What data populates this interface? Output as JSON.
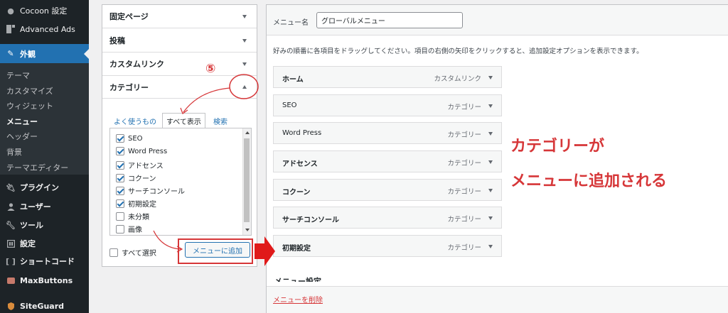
{
  "sidebar": {
    "items": [
      {
        "label": "Cocoon 設定",
        "icon": "circle-icon"
      },
      {
        "label": "Advanced Ads",
        "icon": "ads-icon"
      },
      {
        "label": "外観",
        "icon": "brush-icon"
      },
      {
        "label": "プラグイン",
        "icon": "plugin-icon"
      },
      {
        "label": "ユーザー",
        "icon": "user-icon"
      },
      {
        "label": "ツール",
        "icon": "wrench-icon"
      },
      {
        "label": "設定",
        "icon": "settings-icon"
      },
      {
        "label": "ショートコード",
        "icon": "shortcode-icon"
      },
      {
        "label": "MaxButtons",
        "icon": "maxbuttons-icon"
      },
      {
        "label": "SiteGuard",
        "icon": "siteguard-icon"
      }
    ],
    "submenu": [
      "テーマ",
      "カスタマイズ",
      "ウィジェット",
      "メニュー",
      "ヘッダー",
      "背景",
      "テーマエディター"
    ]
  },
  "left_panel": {
    "sections": [
      "固定ページ",
      "投稿",
      "カスタムリンク",
      "カテゴリー"
    ],
    "tabs": [
      "よく使うもの",
      "すべて表示",
      "検索"
    ],
    "categories": [
      {
        "label": "SEO",
        "checked": true
      },
      {
        "label": "Word Press",
        "checked": true
      },
      {
        "label": "アドセンス",
        "checked": true
      },
      {
        "label": "コクーン",
        "checked": true
      },
      {
        "label": "サーチコンソール",
        "checked": true
      },
      {
        "label": "初期設定",
        "checked": true
      },
      {
        "label": "未分類",
        "checked": false
      },
      {
        "label": "画像",
        "checked": false
      }
    ],
    "select_all_label": "すべて選択",
    "add_button_label": "メニューに追加"
  },
  "right_panel": {
    "menu_name_label": "メニュー名",
    "menu_name_value": "グローバルメニュー",
    "instructions": "好みの順番に各項目をドラッグしてください。項目の右側の矢印をクリックすると、追加設定オプションを表示できます。",
    "menu_items": [
      {
        "title": "ホーム",
        "type": "カスタムリンク"
      },
      {
        "title": "SEO",
        "type": "カテゴリー"
      },
      {
        "title": "Word Press",
        "type": "カテゴリー"
      },
      {
        "title": "アドセンス",
        "type": "カテゴリー"
      },
      {
        "title": "コクーン",
        "type": "カテゴリー"
      },
      {
        "title": "サーチコンソール",
        "type": "カテゴリー"
      },
      {
        "title": "初期設定",
        "type": "カテゴリー"
      }
    ],
    "menu_settings_heading": "メニュー設定",
    "delete_link": "メニューを削除"
  },
  "annotations": {
    "step_number": "⑤",
    "line1": "カテゴリーが",
    "line2": "メニューに追加される",
    "color": "#d63638"
  }
}
